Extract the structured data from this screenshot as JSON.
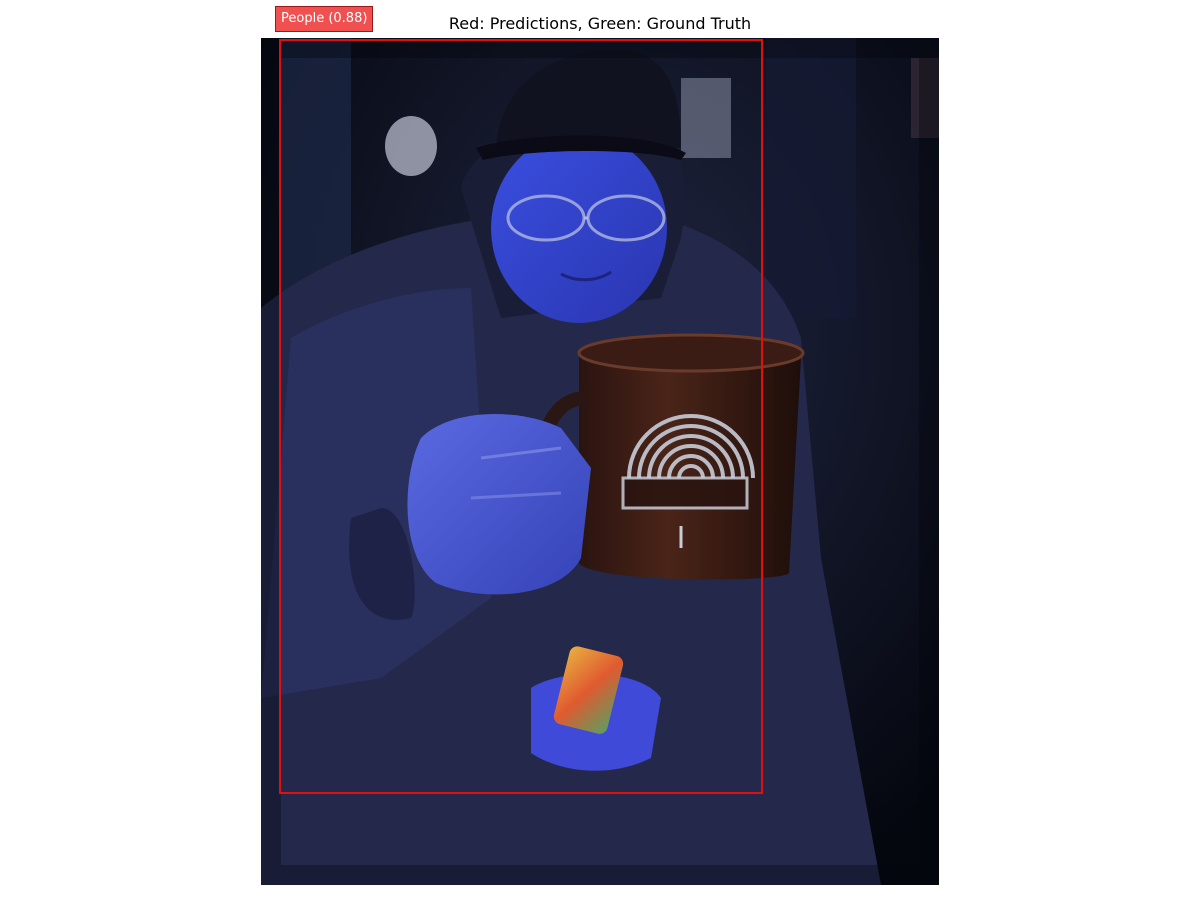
{
  "figure": {
    "title": "Red: Predictions, Green: Ground Truth"
  },
  "detections": {
    "predictions": [
      {
        "label_text": "People (0.88)",
        "class": "People",
        "score": 0.88,
        "color": "#e01010"
      }
    ],
    "ground_truth": []
  },
  "colors": {
    "prediction": "#e01010",
    "prediction_label_bg": "#f05050",
    "ground_truth": "#00c000"
  }
}
